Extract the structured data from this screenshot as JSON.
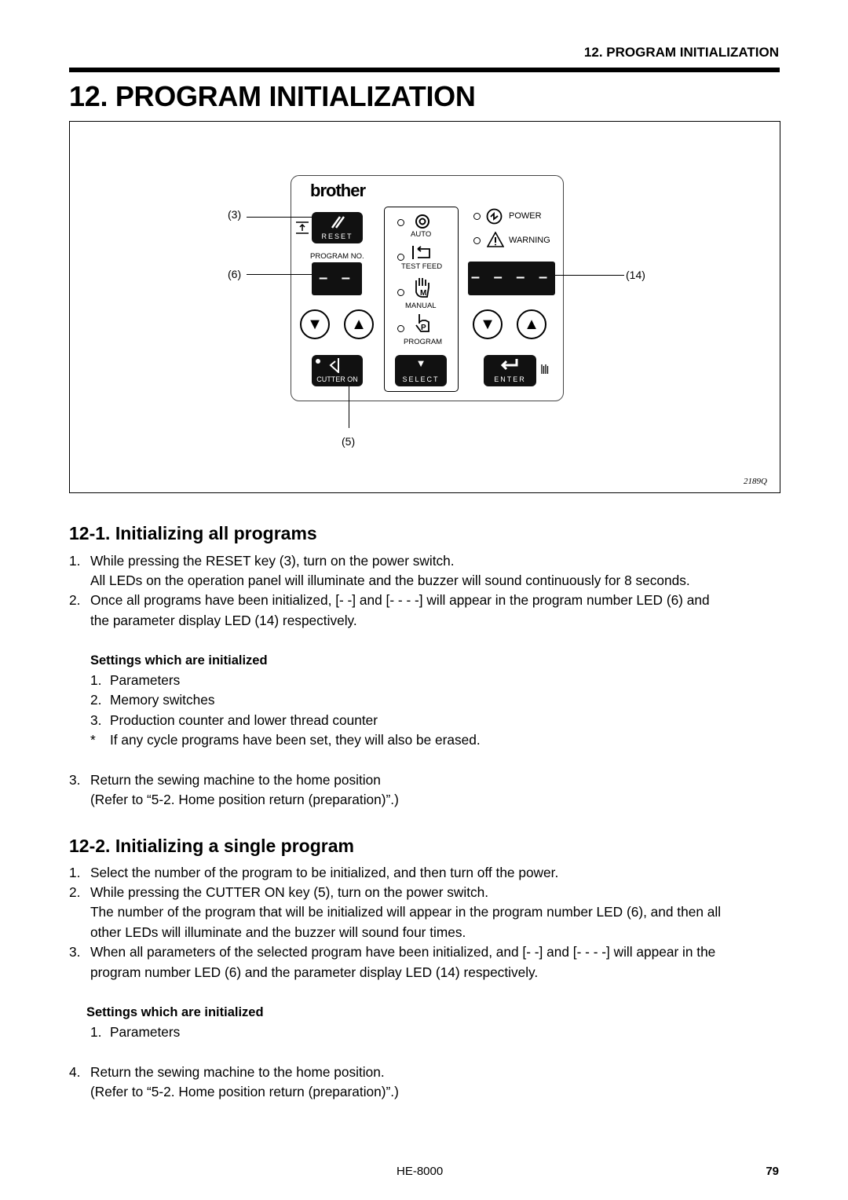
{
  "header": {
    "running_title": "12. PROGRAM INITIALIZATION"
  },
  "title": "12. PROGRAM INITIALIZATION",
  "figure": {
    "logo": "brother",
    "keys": {
      "reset": "RESET",
      "cutter_on": "CUTTER ON",
      "select": "SELECT",
      "enter": "ENTER"
    },
    "program_no_label": "PROGRAM NO.",
    "program_led": "– –",
    "parameter_led": "– – – –",
    "modes": [
      "AUTO",
      "TEST FEED",
      "MANUAL",
      "PROGRAM"
    ],
    "indicators": [
      "POWER",
      "WARNING"
    ],
    "callouts": {
      "reset": "(3)",
      "program_led": "(6)",
      "parameter_led": "(14)",
      "cutter_on": "(5)"
    },
    "figure_code": "2189Q"
  },
  "section1": {
    "heading": "12-1. Initializing all programs",
    "steps_a": [
      {
        "n": "1.",
        "lines": [
          "While pressing the RESET key (3), turn on the power switch.",
          "All LEDs on the operation panel will illuminate and the buzzer will sound continuously for 8 seconds."
        ]
      },
      {
        "n": "2.",
        "lines": [
          "Once all programs have been initialized, [- -] and [- - - -] will appear in the program number LED (6) and",
          "the parameter display LED (14) respectively."
        ]
      }
    ],
    "settings_title": "Settings which are initialized",
    "settings": [
      {
        "n": "1.",
        "t": "Parameters"
      },
      {
        "n": "2.",
        "t": "Memory switches"
      },
      {
        "n": "3.",
        "t": "Production counter and lower thread counter"
      },
      {
        "n": "*",
        "t": "If any cycle programs have been set, they will also be erased."
      }
    ],
    "steps_b": [
      {
        "n": "3.",
        "lines": [
          "Return the sewing machine to the home position",
          "(Refer to “5-2. Home position return (preparation)”.)"
        ]
      }
    ]
  },
  "section2": {
    "heading": "12-2. Initializing a single program",
    "steps_a": [
      {
        "n": "1.",
        "lines": [
          "Select the number of the program to be initialized, and then turn off the power."
        ]
      },
      {
        "n": "2.",
        "lines": [
          "While pressing the CUTTER ON key (5), turn on the power switch.",
          "The number of the program that will be initialized will appear in the program number LED (6), and then all",
          "other LEDs will illuminate and the buzzer will sound four times."
        ]
      },
      {
        "n": "3.",
        "lines": [
          "When all parameters of the selected program have been initialized, and [- -] and [- - - -] will appear in the",
          "program number LED (6) and the parameter display LED (14) respectively."
        ]
      }
    ],
    "settings_title": "Settings which are initialized",
    "settings": [
      {
        "n": "1.",
        "t": "Parameters"
      }
    ],
    "steps_b": [
      {
        "n": "4.",
        "lines": [
          "Return the sewing machine to the home position.",
          "(Refer to “5-2. Home position return (preparation)”.)"
        ]
      }
    ]
  },
  "footer": {
    "model": "HE-8000",
    "page": "79"
  }
}
